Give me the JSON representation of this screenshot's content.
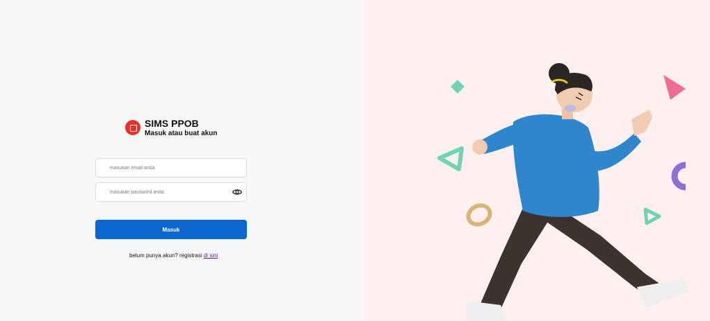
{
  "brand": {
    "name": "SIMS PPOB",
    "tagline": "Masuk atau buat akun"
  },
  "form": {
    "email_placeholder": "masukan email anda",
    "password_placeholder": "masukan password anda",
    "submit_label": "Masuk"
  },
  "register": {
    "prompt": "belum punya akun? registrasi",
    "link_text": "di sini"
  },
  "icons": {
    "logo": "logo-icon",
    "show_password": "eye-icon"
  },
  "colors": {
    "primary": "#0b66d0",
    "brand_red": "#e6322a",
    "left_background": "#f8f8f9",
    "right_background": "#fff0f0"
  }
}
